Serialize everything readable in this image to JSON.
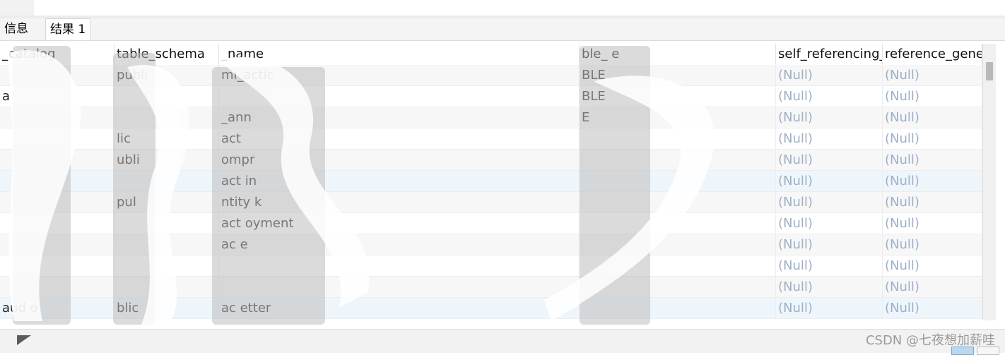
{
  "tabs": {
    "info": "信息",
    "result": "结果 1"
  },
  "columns": [
    {
      "label": "_catalog",
      "key": "c0"
    },
    {
      "label": "table_schema",
      "key": "c1"
    },
    {
      "label": "_name",
      "key": "c2"
    },
    {
      "label": "ble_  e",
      "key": "c3"
    },
    {
      "label": "self_referencing_c",
      "key": "c4"
    },
    {
      "label": "reference_gener",
      "key": "c5"
    }
  ],
  "rows": [
    {
      "c0": "",
      "c1": "publi",
      "c2": "  mi_actic",
      "c3": "BLE",
      "c4": "(Null)",
      "c5": "(Null)"
    },
    {
      "c0": "a",
      "c1": "",
      "c2": "",
      "c3": "BLE",
      "c4": "(Null)",
      "c5": "(Null)"
    },
    {
      "c0": "",
      "c1": "",
      "c2": "  _ann",
      "c3": "E",
      "c4": "(Null)",
      "c5": "(Null)"
    },
    {
      "c0": "",
      "c1": "  lic",
      "c2": "act",
      "c3": "",
      "c4": "(Null)",
      "c5": "(Null)"
    },
    {
      "c0": "",
      "c1": "ubli",
      "c2": "  ompr",
      "c3": "",
      "c4": "(Null)",
      "c5": "(Null)"
    },
    {
      "c0": "",
      "c1": "",
      "c2": "act  in",
      "c3": "",
      "c4": "(Null)",
      "c5": "(Null)"
    },
    {
      "c0": "",
      "c1": "pul",
      "c2": "  ntity  k",
      "c3": "",
      "c4": "(Null)",
      "c5": "(Null)"
    },
    {
      "c0": "",
      "c1": "",
      "c2": "act  oyment",
      "c3": "",
      "c4": "(Null)",
      "c5": "(Null)"
    },
    {
      "c0": "",
      "c1": "",
      "c2": "ac  e",
      "c3": "",
      "c4": "(Null)",
      "c5": "(Null)"
    },
    {
      "c0": "",
      "c1": "",
      "c2": "",
      "c3": "",
      "c4": "(Null)",
      "c5": "(Null)"
    },
    {
      "c0": "",
      "c1": "",
      "c2": "",
      "c3": "",
      "c4": "(Null)",
      "c5": "(Null)"
    },
    {
      "c0": "aud  o",
      "c1": "  blic",
      "c2": "ac  etter",
      "c3": "",
      "c4": "(Null)",
      "c5": "(Null)"
    }
  ],
  "watermark": "CSDN @七夜想加薪哇"
}
